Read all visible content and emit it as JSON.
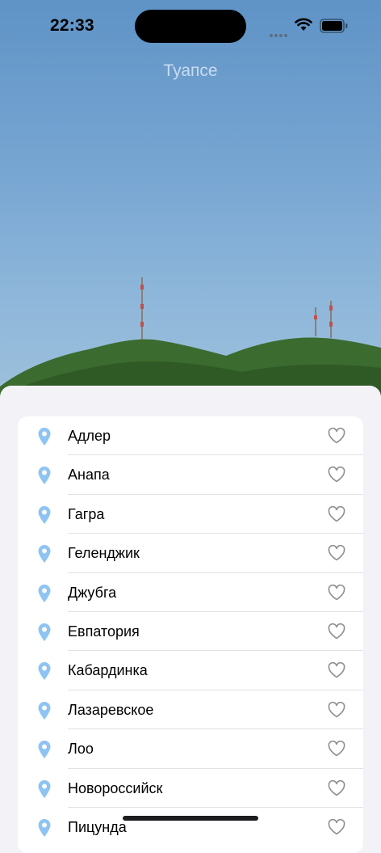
{
  "status": {
    "time": "22:33"
  },
  "header": {
    "title": "Туапсе"
  },
  "icons": {
    "location": "location-pin-icon",
    "favorite": "heart-outline-icon"
  },
  "colors": {
    "pin": "#8ec4f2",
    "heart": "#8e8e93"
  },
  "cities": [
    {
      "name": "Адлер"
    },
    {
      "name": "Анапа"
    },
    {
      "name": "Гагра"
    },
    {
      "name": "Геленджик"
    },
    {
      "name": "Джубга"
    },
    {
      "name": "Евпатория"
    },
    {
      "name": "Кабардинка"
    },
    {
      "name": "Лазаревское"
    },
    {
      "name": "Лоо"
    },
    {
      "name": "Новороссийск"
    },
    {
      "name": "Пицунда"
    }
  ]
}
